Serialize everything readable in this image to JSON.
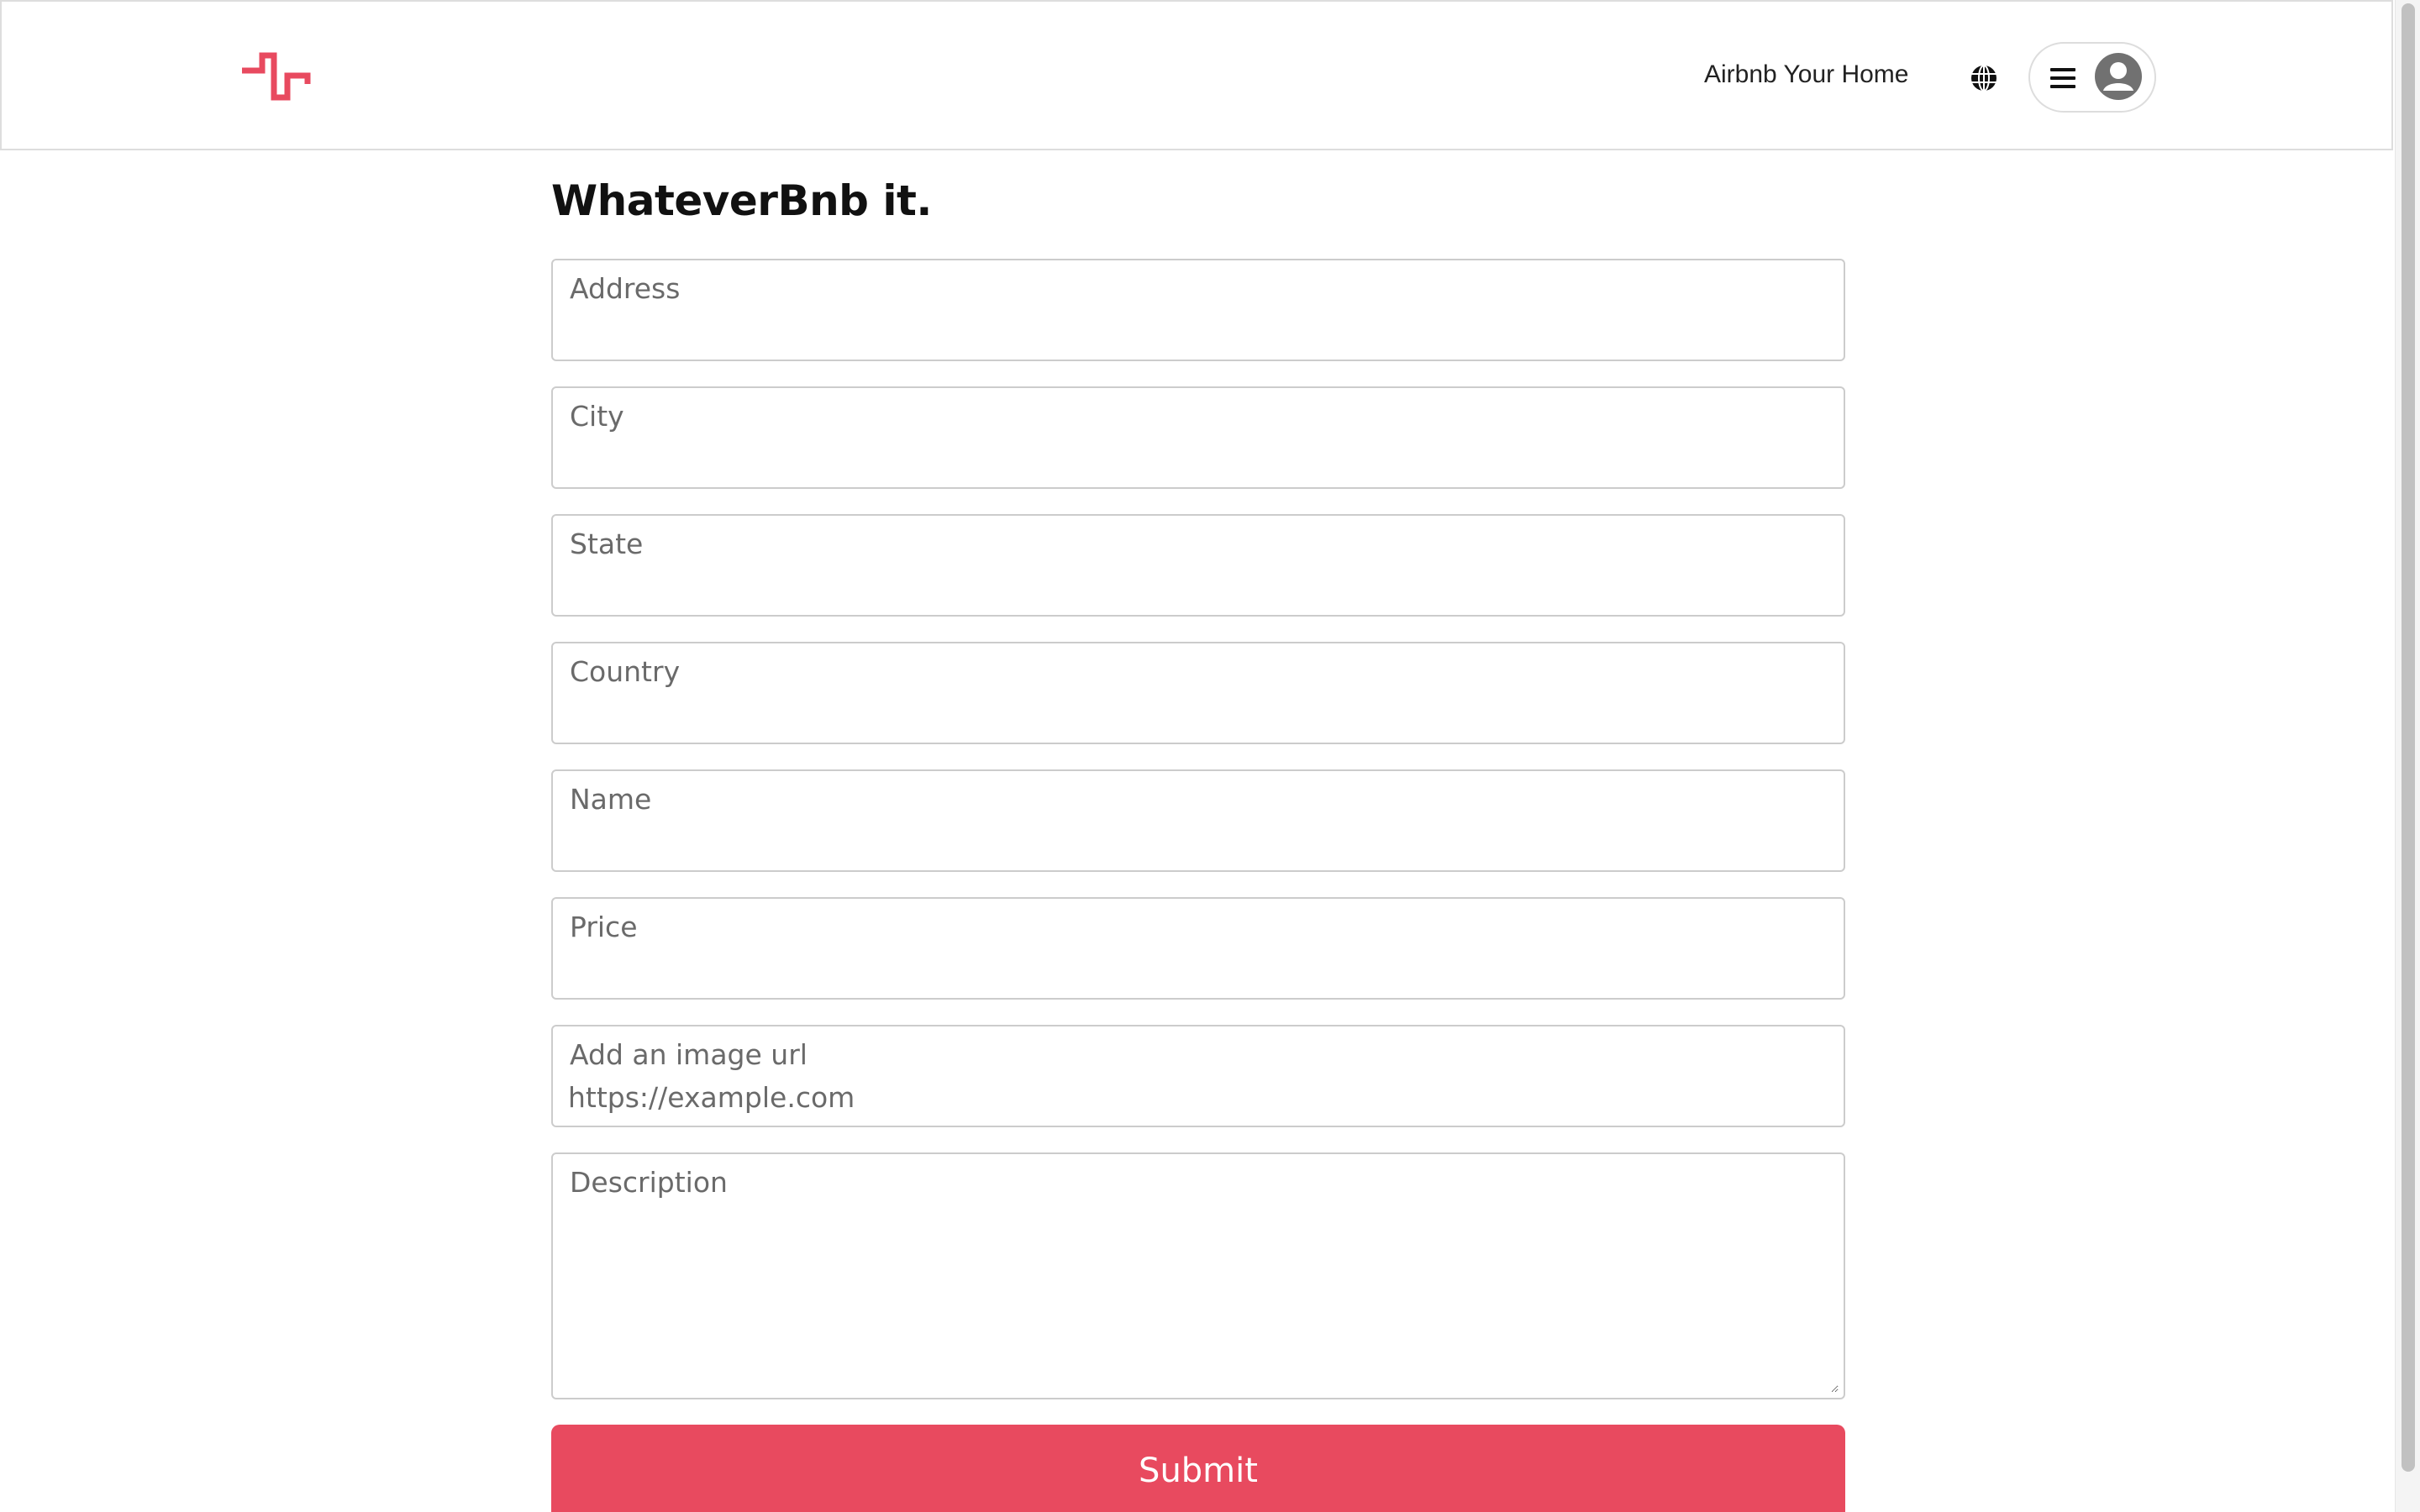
{
  "header": {
    "host_link": "Airbnb Your Home",
    "logo_icon": "logo-icon",
    "globe_icon": "globe-icon",
    "menu_icon": "hamburger-menu-icon",
    "avatar_icon": "user-avatar-icon"
  },
  "form": {
    "title": "WhateverBnb it.",
    "fields": [
      {
        "label": "Address",
        "value": "",
        "placeholder": ""
      },
      {
        "label": "City",
        "value": "",
        "placeholder": ""
      },
      {
        "label": "State",
        "value": "",
        "placeholder": ""
      },
      {
        "label": "Country",
        "value": "",
        "placeholder": ""
      },
      {
        "label": "Name",
        "value": "",
        "placeholder": ""
      },
      {
        "label": "Price",
        "value": "",
        "placeholder": ""
      },
      {
        "label": "Add an image url",
        "value": "",
        "placeholder": "https://example.com"
      }
    ],
    "description": {
      "label": "Description",
      "value": ""
    },
    "submit_label": "Submit"
  },
  "colors": {
    "brand": "#e84a5f",
    "border": "#cccccc",
    "header_border": "#dddddd"
  }
}
